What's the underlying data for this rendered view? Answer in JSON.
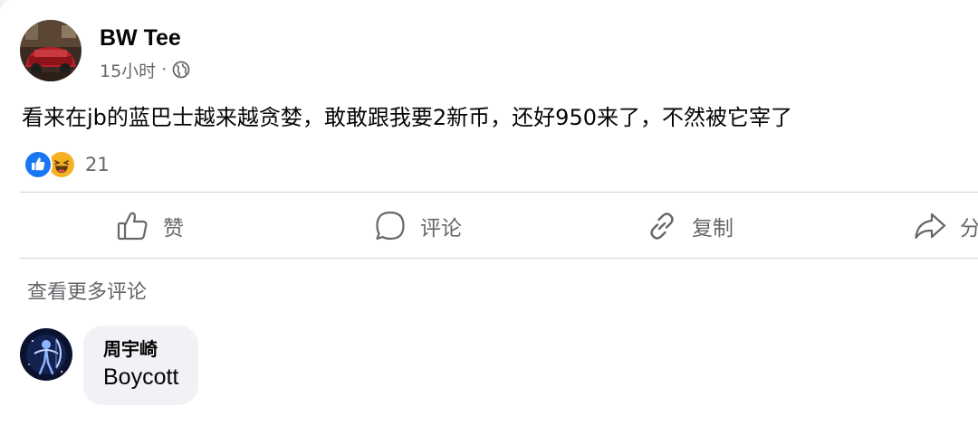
{
  "post": {
    "author_name": "BW Tee",
    "time": "15小时",
    "separator": "·",
    "audience_icon": "globe-icon",
    "text": "看来在jb的蓝巴士越来越贪婪，敢敢跟我要2新币，还好950来了，不然被它宰了",
    "reactions": {
      "icons": [
        "like-reaction-icon",
        "haha-reaction-icon"
      ],
      "count": "21"
    }
  },
  "actions": {
    "like_label": "赞",
    "comment_label": "评论",
    "copy_label": "复制",
    "share_label": "分"
  },
  "comments": {
    "view_more_label": "查看更多评论",
    "items": [
      {
        "name": "周宇崎",
        "text": "Boycott"
      }
    ]
  },
  "colors": {
    "card_bg": "#ffffff",
    "page_bg": "#f0f2f5",
    "text_primary": "#050505",
    "text_secondary": "#65676b",
    "divider": "#ced0d4",
    "like_blue": "#1877f2",
    "haha_yellow": "#f7b125"
  }
}
